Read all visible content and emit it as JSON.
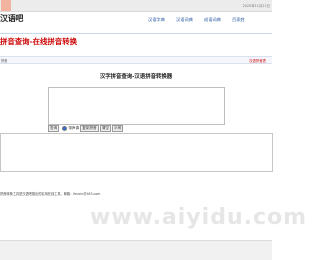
{
  "topbar": {
    "links": "",
    "date": "2025年11月21日"
  },
  "logo": "汉语吧",
  "nav": {
    "item1": "汉语字典",
    "item2": "汉语词典",
    "item3": "成语词典",
    "item4": "百家姓"
  },
  "headline": "拼音查询-在线拼音转换",
  "breadcrumb": "拼音",
  "redtag": "汉语拼音表",
  "tool_title": "汉字拼音查询-汉语拼音转换器",
  "controls": {
    "btn_convert": "查询",
    "radio_tone": "带声调",
    "btn_copy": "复制拼音",
    "btn_clear": "清空",
    "btn_example": "示例"
  },
  "info": {
    "line1": "",
    "line2": "",
    "line3": "",
    "line4": "",
    "line5": "拼音转换工具是汉语吧推出的实用在线工具，邮箱：feuvin@163.com"
  },
  "footer": {
    "row1": "",
    "row2": "",
    "row3": ""
  },
  "watermark": "www.aiyidu.com"
}
